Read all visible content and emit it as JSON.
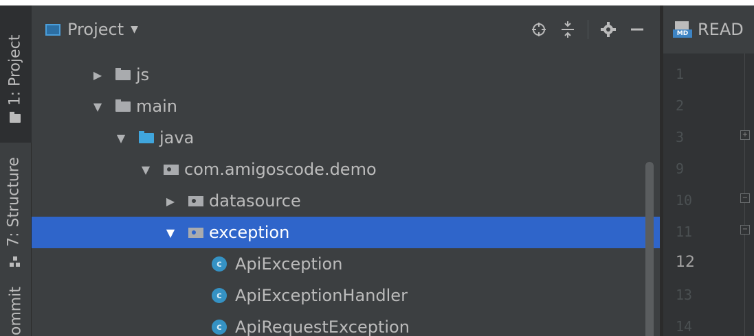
{
  "left_stripe": {
    "tabs": [
      {
        "label": "1: Project",
        "icon": "folder-icon"
      },
      {
        "label": "7: Structure",
        "icon": "structure-icon"
      },
      {
        "label": "Commit",
        "icon": ""
      }
    ]
  },
  "project_panel": {
    "title": "Project",
    "tools": [
      "locate-icon",
      "collapse-all-icon",
      "gear-icon",
      "minimize-icon"
    ],
    "tree": [
      {
        "label": "js",
        "arrow": "▶",
        "icon": "folder"
      },
      {
        "label": "main",
        "arrow": "▼",
        "icon": "folder"
      },
      {
        "label": "java",
        "arrow": "▼",
        "icon": "source-folder"
      },
      {
        "label": "com.amigoscode.demo",
        "arrow": "▼",
        "icon": "package"
      },
      {
        "label": "datasource",
        "arrow": "▶",
        "icon": "package"
      },
      {
        "label": "exception",
        "arrow": "▼",
        "icon": "package",
        "selected": true
      },
      {
        "label": "ApiException",
        "icon": "class"
      },
      {
        "label": "ApiExceptionHandler",
        "icon": "class"
      },
      {
        "label": "ApiRequestException",
        "icon": "class"
      }
    ],
    "class_icon_letter": "c"
  },
  "editor": {
    "tab_label": "READ",
    "tab_icon": "MD",
    "line_numbers": [
      "1",
      "2",
      "3",
      "9",
      "10",
      "11",
      "12",
      "13",
      "14"
    ],
    "current_line": "12"
  },
  "colors": {
    "selection": "#2f65ca",
    "panel_bg": "#3c3f41",
    "editor_bg": "#2b2b2b",
    "source_folder": "#40a6dd",
    "class_icon": "#3592c4"
  }
}
